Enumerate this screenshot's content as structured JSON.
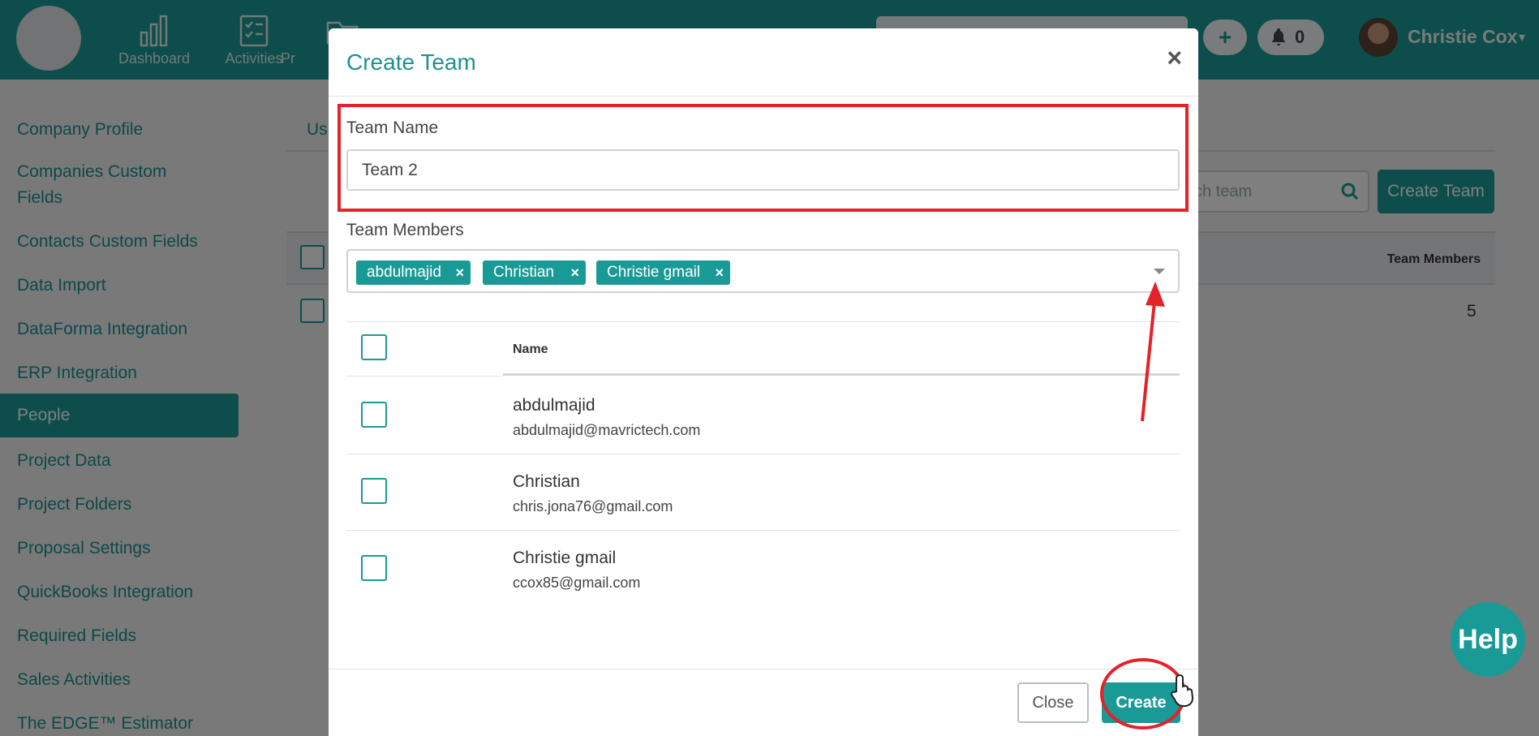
{
  "topbar": {
    "nav": [
      {
        "label": "Dashboard",
        "icon": "bar-chart-icon"
      },
      {
        "label": "Activities",
        "icon": "checklist-icon"
      },
      {
        "label": "Pr",
        "icon": "folder-icon"
      }
    ],
    "notifications_count": "0",
    "user_name": "Christie Cox"
  },
  "sidebar": {
    "items": [
      {
        "label": "Company Profile"
      },
      {
        "label": "Companies Custom Fields"
      },
      {
        "label": "Contacts Custom Fields"
      },
      {
        "label": "Data Import"
      },
      {
        "label": "DataForma Integration"
      },
      {
        "label": "ERP Integration"
      },
      {
        "label": "People",
        "active": true
      },
      {
        "label": "Project Data"
      },
      {
        "label": "Project Folders"
      },
      {
        "label": "Proposal Settings"
      },
      {
        "label": "QuickBooks Integration"
      },
      {
        "label": "Required Fields"
      },
      {
        "label": "Sales Activities"
      },
      {
        "label": "The EDGE™ Estimator"
      }
    ]
  },
  "main": {
    "tab_partial": "Us",
    "search_placeholder_partial": "ch team",
    "create_team_label": "Create Team",
    "table_header_members": "Team Members",
    "row_count": "5"
  },
  "modal": {
    "title": "Create Team",
    "close_icon": "×",
    "team_name_label": "Team Name",
    "team_name_value": "Team 2",
    "team_members_label": "Team Members",
    "selected_tags": [
      {
        "label": "abdulmajid"
      },
      {
        "label": "Christian"
      },
      {
        "label": "Christie gmail"
      }
    ],
    "table_header_name": "Name",
    "members": [
      {
        "name": "abdulmajid",
        "email": "abdulmajid@mavrictech.com"
      },
      {
        "name": "Christian",
        "email": "chris.jona76@gmail.com"
      },
      {
        "name": "Christie gmail",
        "email": "ccox85@gmail.com"
      }
    ],
    "close_button": "Close",
    "create_button": "Create"
  },
  "help_label": "Help",
  "colors": {
    "brand": "#1a9a97",
    "annotation": "#e3222a"
  }
}
